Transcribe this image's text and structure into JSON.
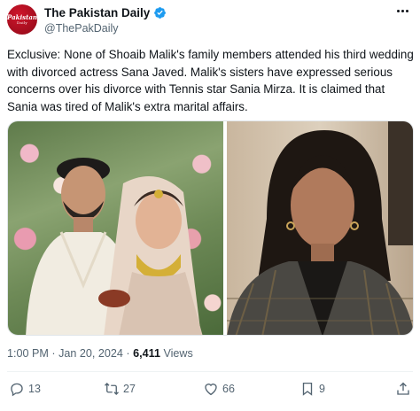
{
  "account": {
    "avatar_line1": "Pakistan",
    "avatar_line2": "Daily",
    "display_name": "The Pakistan Daily",
    "handle": "@ThePakDaily"
  },
  "tweet": {
    "text": "Exclusive: None of Shoaib Malik's family members attended his third wedding with divorced actress Sana Javed. Malik's sisters have expressed serious concerns over his divorce with Tennis star Sania Mirza. It is claimed that Sania was tired of Malik's extra marital affairs.",
    "timestamp": "1:00 PM · Jan 20, 2024 · ",
    "views_count": "6,411",
    "views_label": " Views"
  },
  "actions": {
    "replies": "13",
    "reposts": "27",
    "likes": "66",
    "bookmarks": "9"
  },
  "icons": {
    "verified": "verified-badge",
    "more": "more-horizontal",
    "reply": "speech-bubble",
    "repost": "repost-arrows",
    "like": "heart",
    "bookmark": "bookmark",
    "share": "share-upload"
  },
  "colors": {
    "brand_red": "#b5101f",
    "verified_blue": "#1d9bf0",
    "secondary_text": "#536471"
  }
}
